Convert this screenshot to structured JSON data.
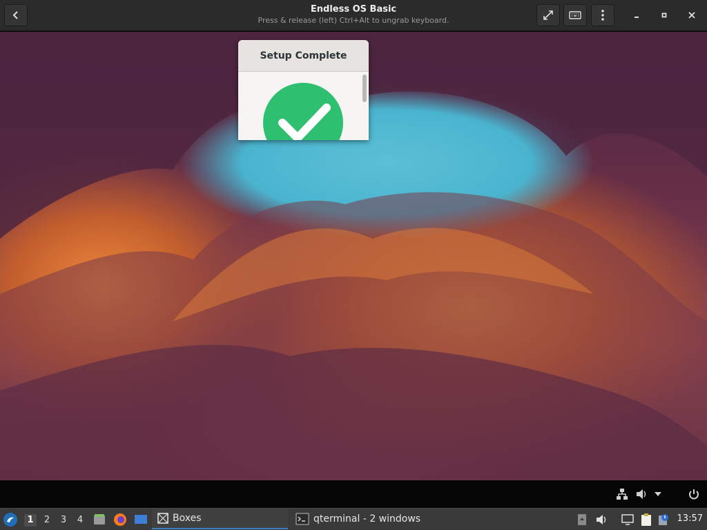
{
  "window": {
    "title": "Endless OS Basic",
    "subtitle": "Press & release (left) Ctrl+Alt to ungrab keyboard."
  },
  "dialog": {
    "title": "Setup Complete"
  },
  "taskbar": {
    "workspaces": [
      "1",
      "2",
      "3",
      "4"
    ],
    "active_workspace": "1",
    "tasks": [
      {
        "label": "Boxes",
        "active": true
      },
      {
        "label": "qterminal - 2 windows",
        "active": false
      }
    ],
    "clock": "13:57"
  },
  "colors": {
    "titlebar": "#2b2b2b",
    "check_green": "#2fbf71",
    "taskbar": "#3a3a3a",
    "accent": "#3d7fc4"
  }
}
